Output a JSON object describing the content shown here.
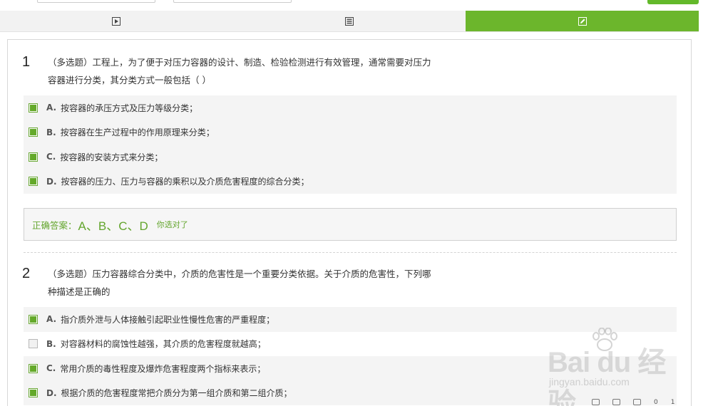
{
  "tabs": [
    {
      "name": "video",
      "icon": "play-icon"
    },
    {
      "name": "doc",
      "icon": "document-icon"
    },
    {
      "name": "edit",
      "icon": "edit-icon",
      "active": true
    }
  ],
  "colors": {
    "accent": "#6cb62c",
    "answer_text": "#63a52d"
  },
  "questions": [
    {
      "number": "1",
      "text": "（多选题）工程上，为了便于对压力容器的设计、制造、检验检测进行有效管理，通常需要对压力容器进行分类，其分类方式一般包括（ ）",
      "options": [
        {
          "letter": "A.",
          "text": "按容器的承压方式及压力等级分类；",
          "checked": true
        },
        {
          "letter": "B.",
          "text": "按容器在生产过程中的作用原理来分类；",
          "checked": true
        },
        {
          "letter": "C.",
          "text": "按容器的安装方式来分类；",
          "checked": true
        },
        {
          "letter": "D.",
          "text": "按容器的压力、压力与容器的乘积以及介质危害程度的综合分类；",
          "checked": true
        }
      ],
      "answer_label": "正确答案：",
      "answer_letters": "A、B、C、D",
      "answer_result": "你选对了"
    },
    {
      "number": "2",
      "text": "（多选题）压力容器综合分类中，介质的危害性是一个重要分类依据。关于介质的危害性，下列哪种描述是正确的",
      "options": [
        {
          "letter": "A.",
          "text": "指介质外泄与人体接触引起职业性慢性危害的严重程度；",
          "checked": true
        },
        {
          "letter": "B.",
          "text": "对容器材料的腐蚀性越强，其介质的危害程度就越高；",
          "checked": false
        },
        {
          "letter": "C.",
          "text": "常用介质的毒性程度及爆炸危害程度两个指标来表示；",
          "checked": true
        },
        {
          "letter": "D.",
          "text": "根据介质的危害程度常把介质分为第一组介质和第二组介质；",
          "checked": true
        }
      ]
    }
  ],
  "watermark": {
    "brand": "Bai du 经验",
    "url": "jingyan.baidu.com"
  },
  "status": {
    "count_a": "0",
    "count_b": "1"
  }
}
